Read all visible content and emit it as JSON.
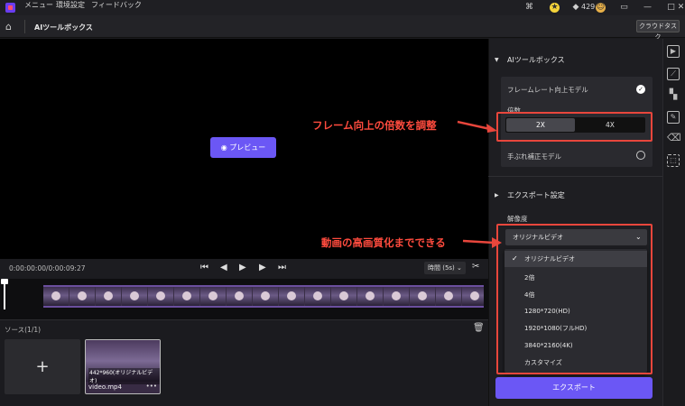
{
  "titlebar": {
    "menu": [
      "メニュー",
      "環境設定",
      "フィードバック"
    ],
    "credits": "429"
  },
  "toolbar": {
    "title": "AIツールボックス",
    "cloud_button": "クラウドタスク"
  },
  "preview": {
    "button": "プレビュー"
  },
  "controls": {
    "timecode": "0:00:00:00/0:00:09:27",
    "time_select": "時間 (5s)"
  },
  "source": {
    "label": "ソース(1/1)",
    "video_resolution": "442*960(オリジナルビデオ)",
    "video_name": "video.mp4"
  },
  "panel": {
    "ai_section": "AIツールボックス",
    "frame_model": "フレームレート向上モデル",
    "multiplier_label": "倍数",
    "multiplier_options": [
      "2X",
      "4X"
    ],
    "stabilize_model": "手ぶれ補正モデル",
    "export_section": "エクスポート設定",
    "resolution_label": "解像度",
    "resolution_selected": "オリジナルビデオ",
    "resolution_options": [
      "オリジナルビデオ",
      "2倍",
      "4倍",
      "1280*720(HD)",
      "1920*1080(フルHD)",
      "3840*2160(4K)",
      "カスタマイズ"
    ],
    "export_button": "エクスポート"
  },
  "annotations": {
    "frame_note": "フレーム向上の倍数を調整",
    "quality_note": "動画の高画質化までできる"
  },
  "colors": {
    "accent": "#6b57f5",
    "annotation": "#e8463c"
  }
}
